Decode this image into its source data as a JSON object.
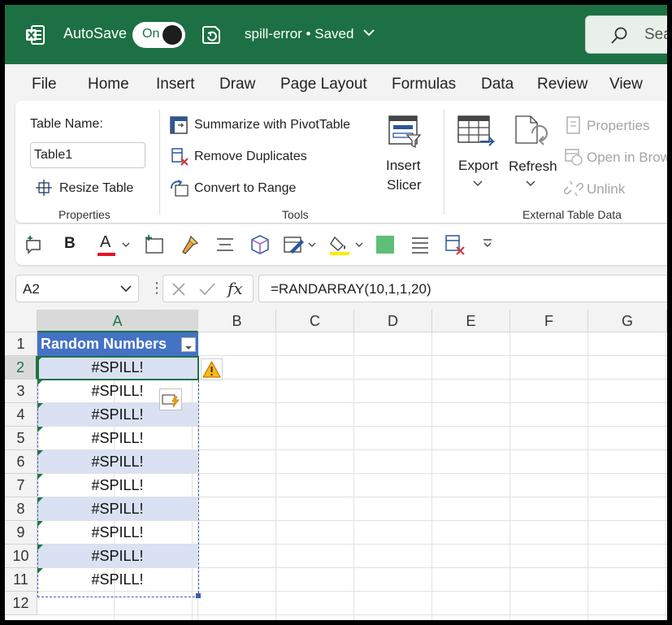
{
  "titlebar": {
    "autosave_label": "AutoSave",
    "toggle_state": "On",
    "doc_name": "spill-error • Saved",
    "search_placeholder": "Sea"
  },
  "menu": [
    "File",
    "Home",
    "Insert",
    "Draw",
    "Page Layout",
    "Formulas",
    "Data",
    "Review",
    "View"
  ],
  "ribbon": {
    "properties": {
      "table_name_label": "Table Name:",
      "table_name_value": "Table1",
      "resize_table": "Resize Table",
      "group_label": "Properties"
    },
    "tools": {
      "summarize": "Summarize with PivotTable",
      "remove_duplicates": "Remove Duplicates",
      "convert_to_range": "Convert to Range",
      "group_label": "Tools"
    },
    "insert_slicer": {
      "line1": "Insert",
      "line2": "Slicer"
    },
    "external": {
      "export": "Export",
      "refresh": "Refresh",
      "properties": "Properties",
      "open_in_browser": "Open in Brow",
      "unlink": "Unlink",
      "group_label": "External Table Data"
    }
  },
  "formula_bar": {
    "name_box": "A2",
    "fx": "fx",
    "formula": "=RANDARRAY(10,1,1,20)"
  },
  "grid": {
    "columns": [
      "A",
      "B",
      "C",
      "D",
      "E",
      "F",
      "G"
    ],
    "rows": [
      "1",
      "2",
      "3",
      "4",
      "5",
      "6",
      "7",
      "8",
      "9",
      "10",
      "11",
      "12"
    ],
    "header_cell": "Random Numbers",
    "cells": [
      "#SPILL!",
      "#SPILL!",
      "#SPILL!",
      "#SPILL!",
      "#SPILL!",
      "#SPILL!",
      "#SPILL!",
      "#SPILL!",
      "#SPILL!",
      "#SPILL!"
    ]
  },
  "colors": {
    "title_green": "#1d7044",
    "table_header_blue": "#4472c4",
    "band_blue": "#d9e1f2",
    "error_triangle": "#1b7a3c"
  }
}
